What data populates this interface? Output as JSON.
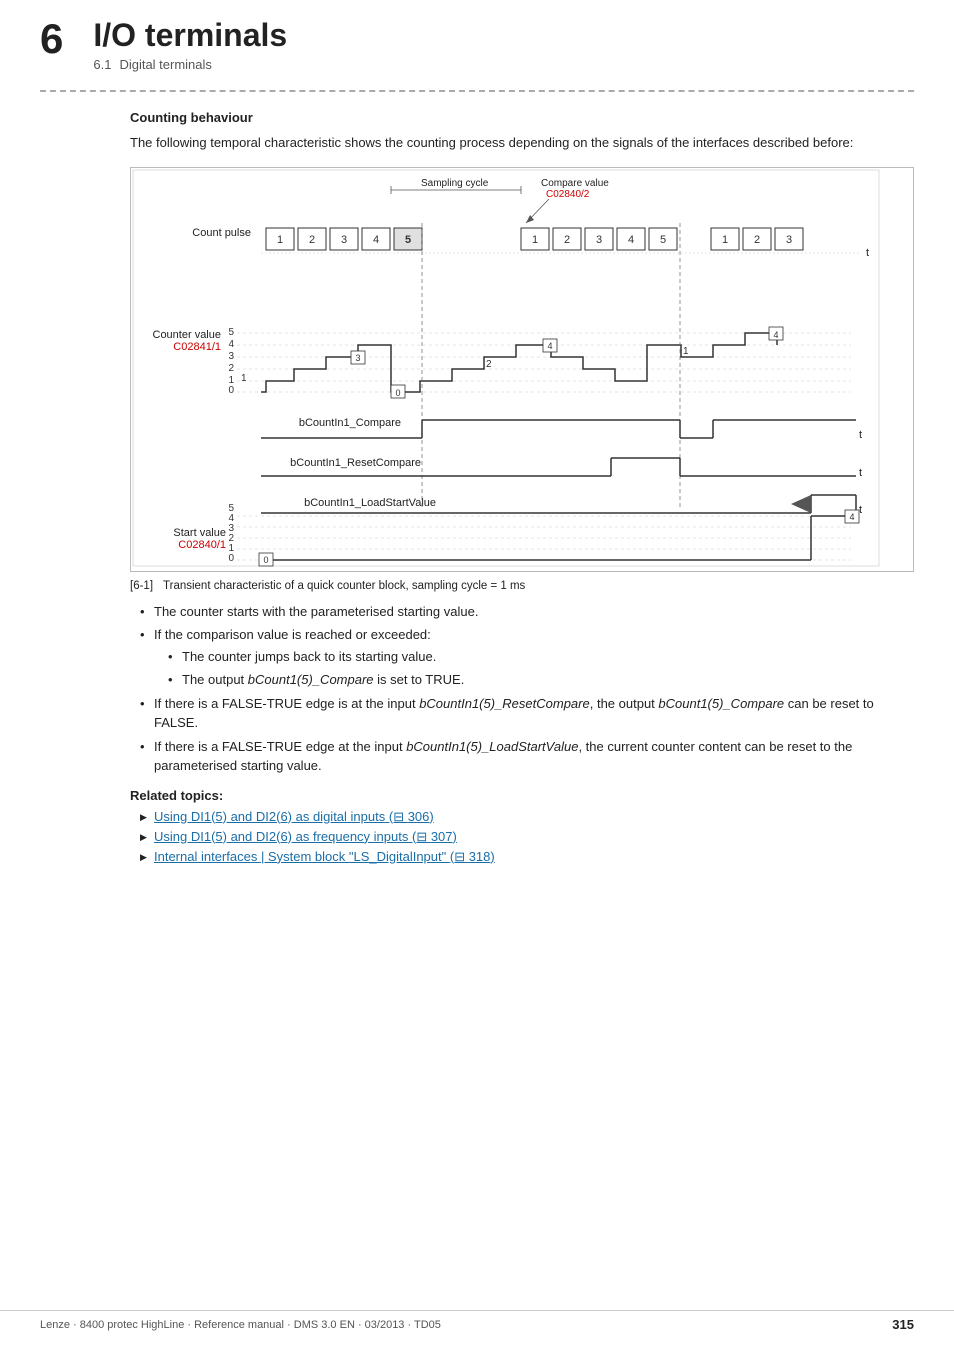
{
  "header": {
    "chapter_number": "6",
    "chapter_title": "I/O terminals",
    "section_number": "6.1",
    "section_title": "Digital terminals"
  },
  "section": {
    "counting_title": "Counting behaviour",
    "intro": "The following temporal characteristic shows the counting process depending on the signals of the interfaces described before:"
  },
  "diagram": {
    "caption_ref": "[6-1]",
    "caption_text": "Transient characteristic of a quick counter block, sampling cycle = 1 ms",
    "sampling_label": "Sampling cycle",
    "compare_label": "Compare value",
    "compare_code": "C02840/2",
    "count_pulse_label": "Count pulse",
    "counter_value_label": "Counter value",
    "counter_code": "C02841/1",
    "bcount_compare": "bCountIn1_Compare",
    "bcount_reset": "bCountIn1_ResetCompare",
    "bcount_load": "bCountIn1_LoadStartValue",
    "start_value_label": "Start value",
    "start_code": "C02840/1",
    "t_label": "t"
  },
  "bullets": [
    {
      "text": "The counter starts with the parameterised starting value.",
      "sub": []
    },
    {
      "text": "If the comparison value is reached or exceeded:",
      "sub": [
        "The counter jumps back to its starting value.",
        "The output bCount1(5)_Compare is set to TRUE."
      ]
    },
    {
      "text": "If there is a FALSE-TRUE edge is at the input bCountIn1(5)_ResetCompare, the output bCount1(5)_Compare can be reset to FALSE.",
      "sub": []
    },
    {
      "text": "If there is a FALSE-TRUE edge at the input bCountIn1(5)_LoadStartValue, the current counter content can be reset to the parameterised starting value.",
      "sub": []
    }
  ],
  "related_topics": {
    "title": "Related topics:",
    "items": [
      {
        "text": "Using DI1(5) and DI2(6) as digital inputs",
        "page": "306"
      },
      {
        "text": "Using DI1(5) and DI2(6) as frequency inputs",
        "page": "307"
      },
      {
        "text": "Internal interfaces | System block \"LS_DigitalInput\"",
        "page": "318"
      }
    ]
  },
  "footer": {
    "left": "Lenze · 8400 protec HighLine · Reference manual · DMS 3.0 EN · 03/2013 · TD05",
    "page": "315"
  }
}
